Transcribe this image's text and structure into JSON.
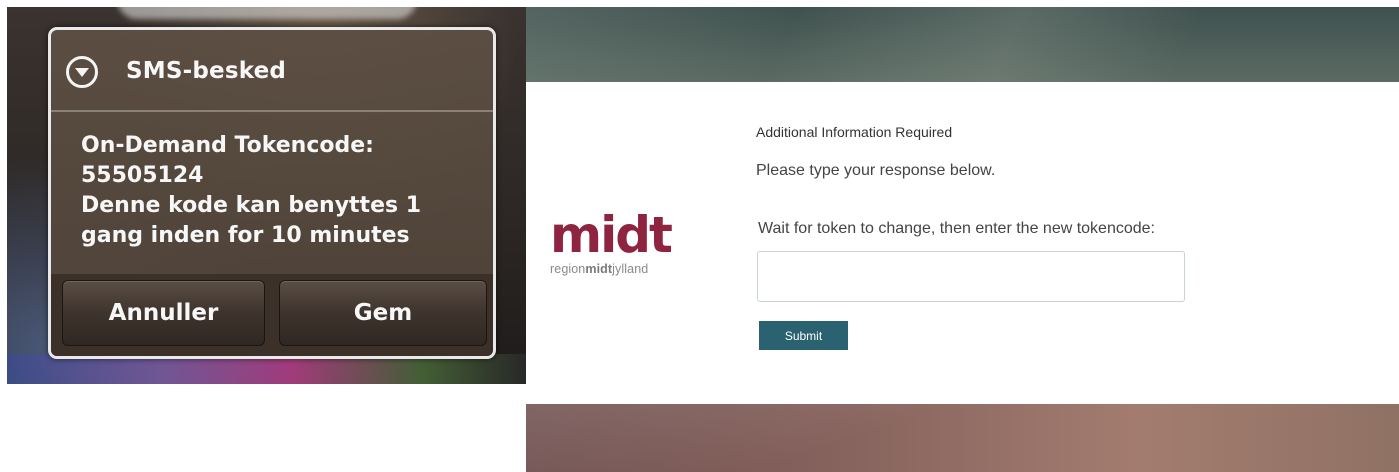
{
  "sms_dialog": {
    "title": "SMS-besked",
    "header_icon": "chevron-down-circle-icon",
    "message_lines": [
      "On-Demand Tokencode:",
      "55505124",
      "Denne kode kan benyttes 1",
      "gang inden for  10 minutes"
    ],
    "cancel_label": "Annuller",
    "save_label": "Gem"
  },
  "login_page": {
    "logo": {
      "word": "midt",
      "sub_prefix": "region",
      "sub_bold": "midt",
      "sub_suffix": "jylland"
    },
    "heading": "Additional Information Required",
    "instruction": "Please type your response below.",
    "field_label": "Wait for token to change, then enter the new tokencode:",
    "token_value": "",
    "submit_label": "Submit"
  },
  "colors": {
    "brand_logo": "#8e2440",
    "submit_button": "#2b6272"
  }
}
